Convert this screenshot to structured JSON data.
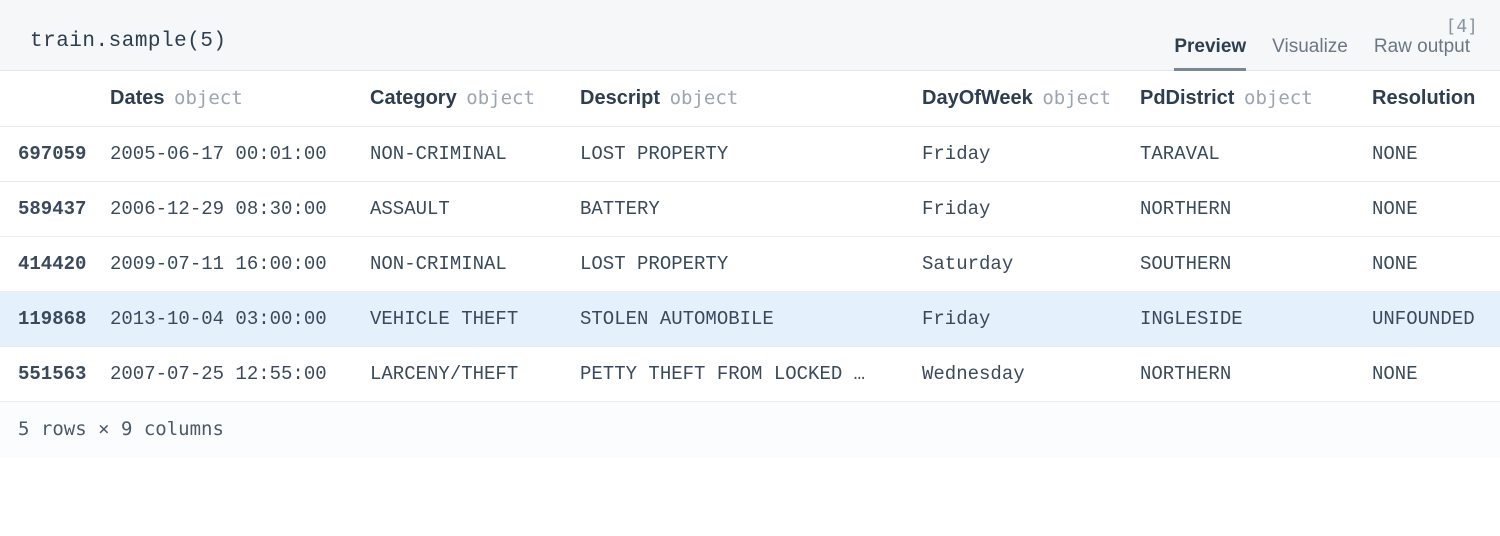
{
  "cell": {
    "code": "train.sample(5)",
    "exec_count": "[4]"
  },
  "tabs": {
    "preview": "Preview",
    "visualize": "Visualize",
    "raw": "Raw output"
  },
  "columns": [
    {
      "name": "Dates",
      "dtype": "object"
    },
    {
      "name": "Category",
      "dtype": "object"
    },
    {
      "name": "Descript",
      "dtype": "object"
    },
    {
      "name": "DayOfWeek",
      "dtype": "object"
    },
    {
      "name": "PdDistrict",
      "dtype": "object"
    },
    {
      "name": "Resolution",
      "dtype": ""
    }
  ],
  "rows": [
    {
      "idx": "697059",
      "Dates": "2005-06-17 00:01:00",
      "Category": "NON-CRIMINAL",
      "Descript": "LOST PROPERTY",
      "DayOfWeek": "Friday",
      "PdDistrict": "TARAVAL",
      "Resolution": "NONE",
      "highlight": false
    },
    {
      "idx": "589437",
      "Dates": "2006-12-29 08:30:00",
      "Category": "ASSAULT",
      "Descript": "BATTERY",
      "DayOfWeek": "Friday",
      "PdDistrict": "NORTHERN",
      "Resolution": "NONE",
      "highlight": false
    },
    {
      "idx": "414420",
      "Dates": "2009-07-11 16:00:00",
      "Category": "NON-CRIMINAL",
      "Descript": "LOST PROPERTY",
      "DayOfWeek": "Saturday",
      "PdDistrict": "SOUTHERN",
      "Resolution": "NONE",
      "highlight": false
    },
    {
      "idx": "119868",
      "Dates": "2013-10-04 03:00:00",
      "Category": "VEHICLE THEFT",
      "Descript": "STOLEN AUTOMOBILE",
      "DayOfWeek": "Friday",
      "PdDistrict": "INGLESIDE",
      "Resolution": "UNFOUNDED",
      "highlight": true
    },
    {
      "idx": "551563",
      "Dates": "2007-07-25 12:55:00",
      "Category": "LARCENY/THEFT",
      "Descript": "PETTY THEFT FROM LOCKED …",
      "DayOfWeek": "Wednesday",
      "PdDistrict": "NORTHERN",
      "Resolution": "NONE",
      "highlight": false
    }
  ],
  "footer": "5 rows × 9 columns"
}
